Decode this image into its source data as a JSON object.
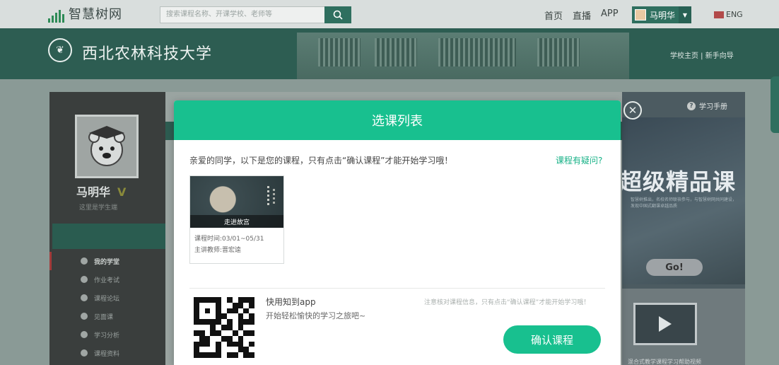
{
  "topnav": {
    "logo_text": "智慧树网",
    "search_placeholder": "搜索课程名称、开课学校、老师等",
    "links": [
      "首页",
      "直播",
      "APP"
    ],
    "user_name": "马明华",
    "lang": "ENG"
  },
  "banner": {
    "school_name": "西北农林科技大学",
    "links": "学校主页 | 新手向导"
  },
  "sidebar": {
    "user_name": "马明华",
    "vip_badge": "V",
    "subtitle": "这里是学生端",
    "menu": [
      {
        "label": "我的学堂",
        "icon": "home-icon"
      },
      {
        "label": "作业考试",
        "icon": "pencil-icon"
      },
      {
        "label": "课程论坛",
        "icon": "forum-icon"
      },
      {
        "label": "见面课",
        "icon": "meeting-icon"
      },
      {
        "label": "学习分析",
        "icon": "analysis-icon"
      },
      {
        "label": "课程资料",
        "icon": "material-icon"
      }
    ]
  },
  "rightpanel": {
    "manual": "学习手册",
    "promo_title": "超级精品课",
    "promo_sub": "智慧树推出，名校名师联袂参与，与智慧树网共同建设，发现中国式翻课卓越品质",
    "go": "Go!",
    "video_caption": "混合式教学课程学习帮助视频"
  },
  "modal": {
    "title": "选课列表",
    "notice": "亲爱的同学，以下是您的课程，只有点击“确认课程”才能开始学习哦！",
    "question_link": "课程有疑问?",
    "course": {
      "name": "走进故宫",
      "time": "课程时间:03/01~05/31",
      "teacher": "主讲教师:晋宏逵"
    },
    "app_title": "快用知到app",
    "app_sub": "开始轻松愉快的学习之旅吧~",
    "tip": "注意核对课程信息，只有点击“确认课程”才能开始学习哦！",
    "confirm": "确认课程"
  },
  "colors": {
    "accent": "#18c08f",
    "dark_green": "#2d5d52"
  }
}
